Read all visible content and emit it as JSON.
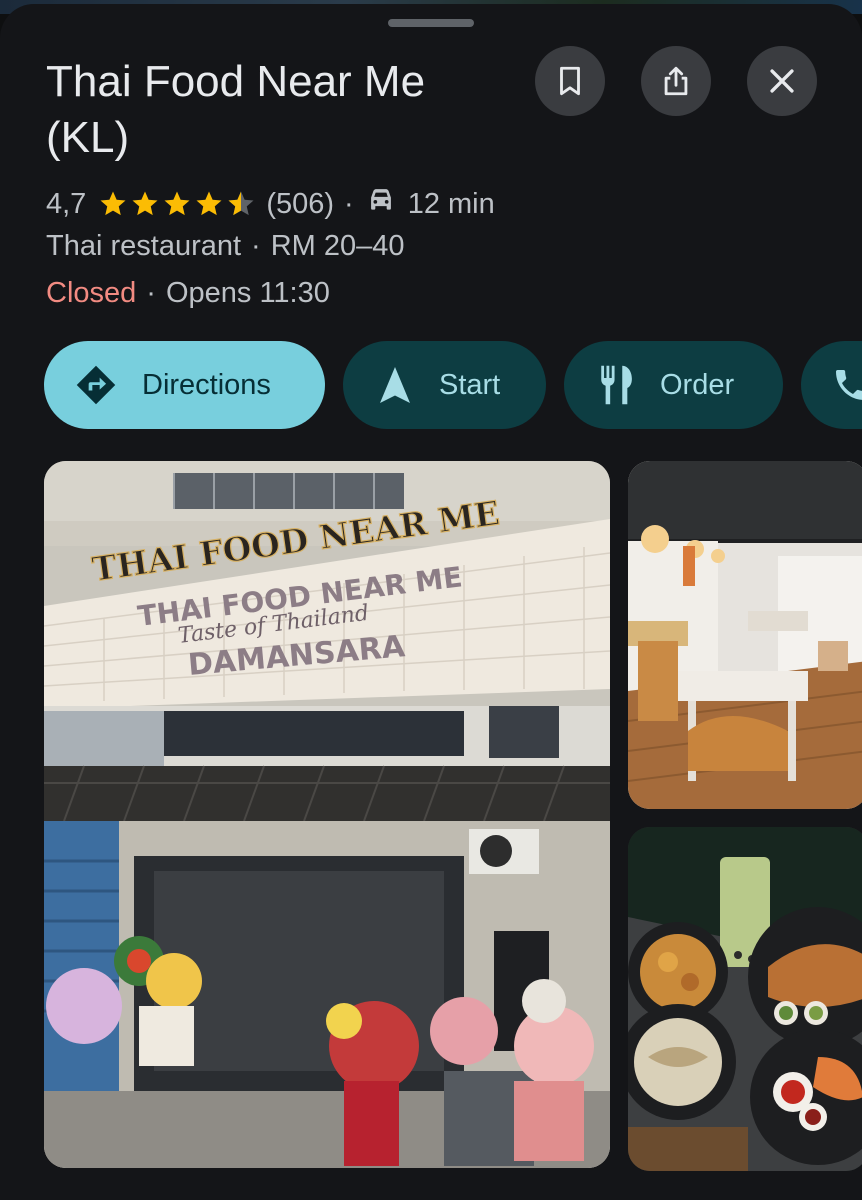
{
  "place": {
    "name": "Thai Food Near Me (KL)",
    "rating": "4,7",
    "rating_value": 4.7,
    "review_count": "(506)",
    "drive_time": "12 min",
    "category": "Thai restaurant",
    "price_range": "RM 20–40",
    "status": "Closed",
    "opens": "Opens 11:30"
  },
  "separator": "·",
  "actions": {
    "directions": "Directions",
    "start": "Start",
    "order": "Order"
  },
  "signage": {
    "top": "THAI FOOD NEAR ME",
    "middle": "THAI FOOD NEAR ME",
    "script": "Taste of Thailand",
    "bottom": "DAMANSARA"
  },
  "icons": {
    "save": "bookmark-icon",
    "share": "share-icon",
    "close": "close-icon",
    "car": "car-icon",
    "directions": "directions-icon",
    "start": "navigation-icon",
    "order": "utensils-icon",
    "call": "phone-icon"
  },
  "colors": {
    "accent": "#78cfdd",
    "chip_bg": "#0d3d42",
    "star": "#fbbc04",
    "closed": "#f28b82"
  }
}
